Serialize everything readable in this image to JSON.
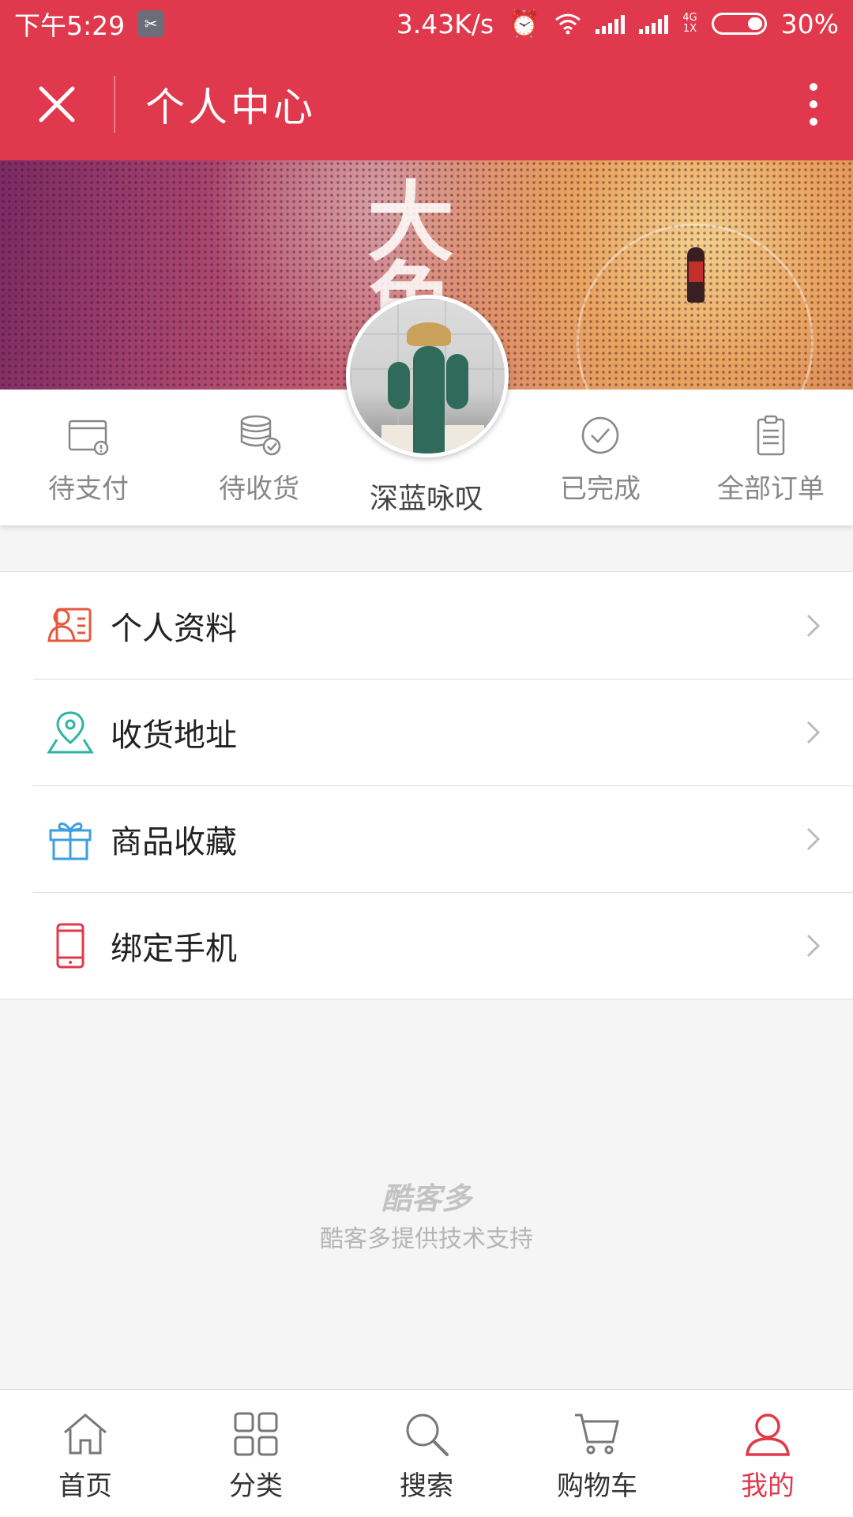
{
  "status_bar": {
    "time": "下午5:29",
    "net_speed": "3.43K/s",
    "network": "4G\n1X",
    "battery": "30%"
  },
  "header": {
    "title": "个人中心"
  },
  "banner": {
    "text": "大鱼"
  },
  "user": {
    "nickname": "深蓝咏叹"
  },
  "orders": [
    {
      "label": "待支付",
      "icon": "wallet-alert-icon"
    },
    {
      "label": "待收货",
      "icon": "coins-check-icon"
    },
    {
      "label": "已完成",
      "icon": "check-circle-icon"
    },
    {
      "label": "全部订单",
      "icon": "clipboard-icon"
    }
  ],
  "menu": [
    {
      "label": "个人资料",
      "icon": "profile-card-icon",
      "color": "#e8573c"
    },
    {
      "label": "收货地址",
      "icon": "map-pin-icon",
      "color": "#2ab6a0"
    },
    {
      "label": "商品收藏",
      "icon": "gift-icon",
      "color": "#3d9ee0"
    },
    {
      "label": "绑定手机",
      "icon": "phone-icon",
      "color": "#e0384c"
    }
  ],
  "footer": {
    "logo": "酷客多",
    "text": "酷客多提供技术支持"
  },
  "bottom_nav": [
    {
      "label": "首页",
      "icon": "home-icon"
    },
    {
      "label": "分类",
      "icon": "grid-icon"
    },
    {
      "label": "搜索",
      "icon": "search-icon"
    },
    {
      "label": "购物车",
      "icon": "cart-icon"
    },
    {
      "label": "我的",
      "icon": "user-icon",
      "active": true
    }
  ],
  "colors": {
    "primary": "#e0384c",
    "background": "#f5f5f5"
  }
}
